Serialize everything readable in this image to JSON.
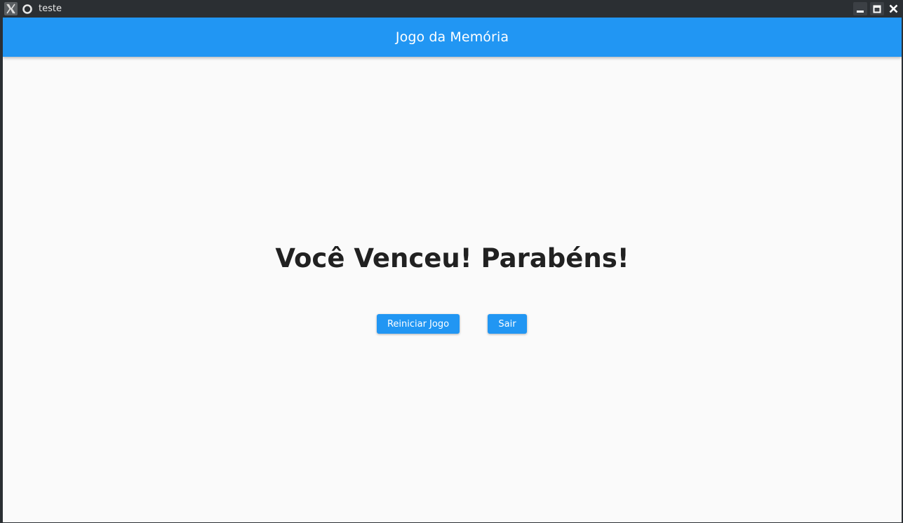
{
  "window": {
    "title": "teste",
    "icons": {
      "system": "x-window-icon",
      "app": "app-icon",
      "minimize": "minimize-icon",
      "maximize": "maximize-icon",
      "close": "close-icon"
    },
    "colors": {
      "titlebar": "#2b2f33"
    }
  },
  "appbar": {
    "title": "Jogo da Memória",
    "color": "#2196f3"
  },
  "main": {
    "message": "Você Venceu! Parabéns!",
    "buttons": {
      "restart_label": "Reiniciar Jogo",
      "exit_label": "Sair"
    },
    "colors": {
      "background": "#fafafa",
      "button": "#2196f3",
      "text": "#212121"
    }
  }
}
